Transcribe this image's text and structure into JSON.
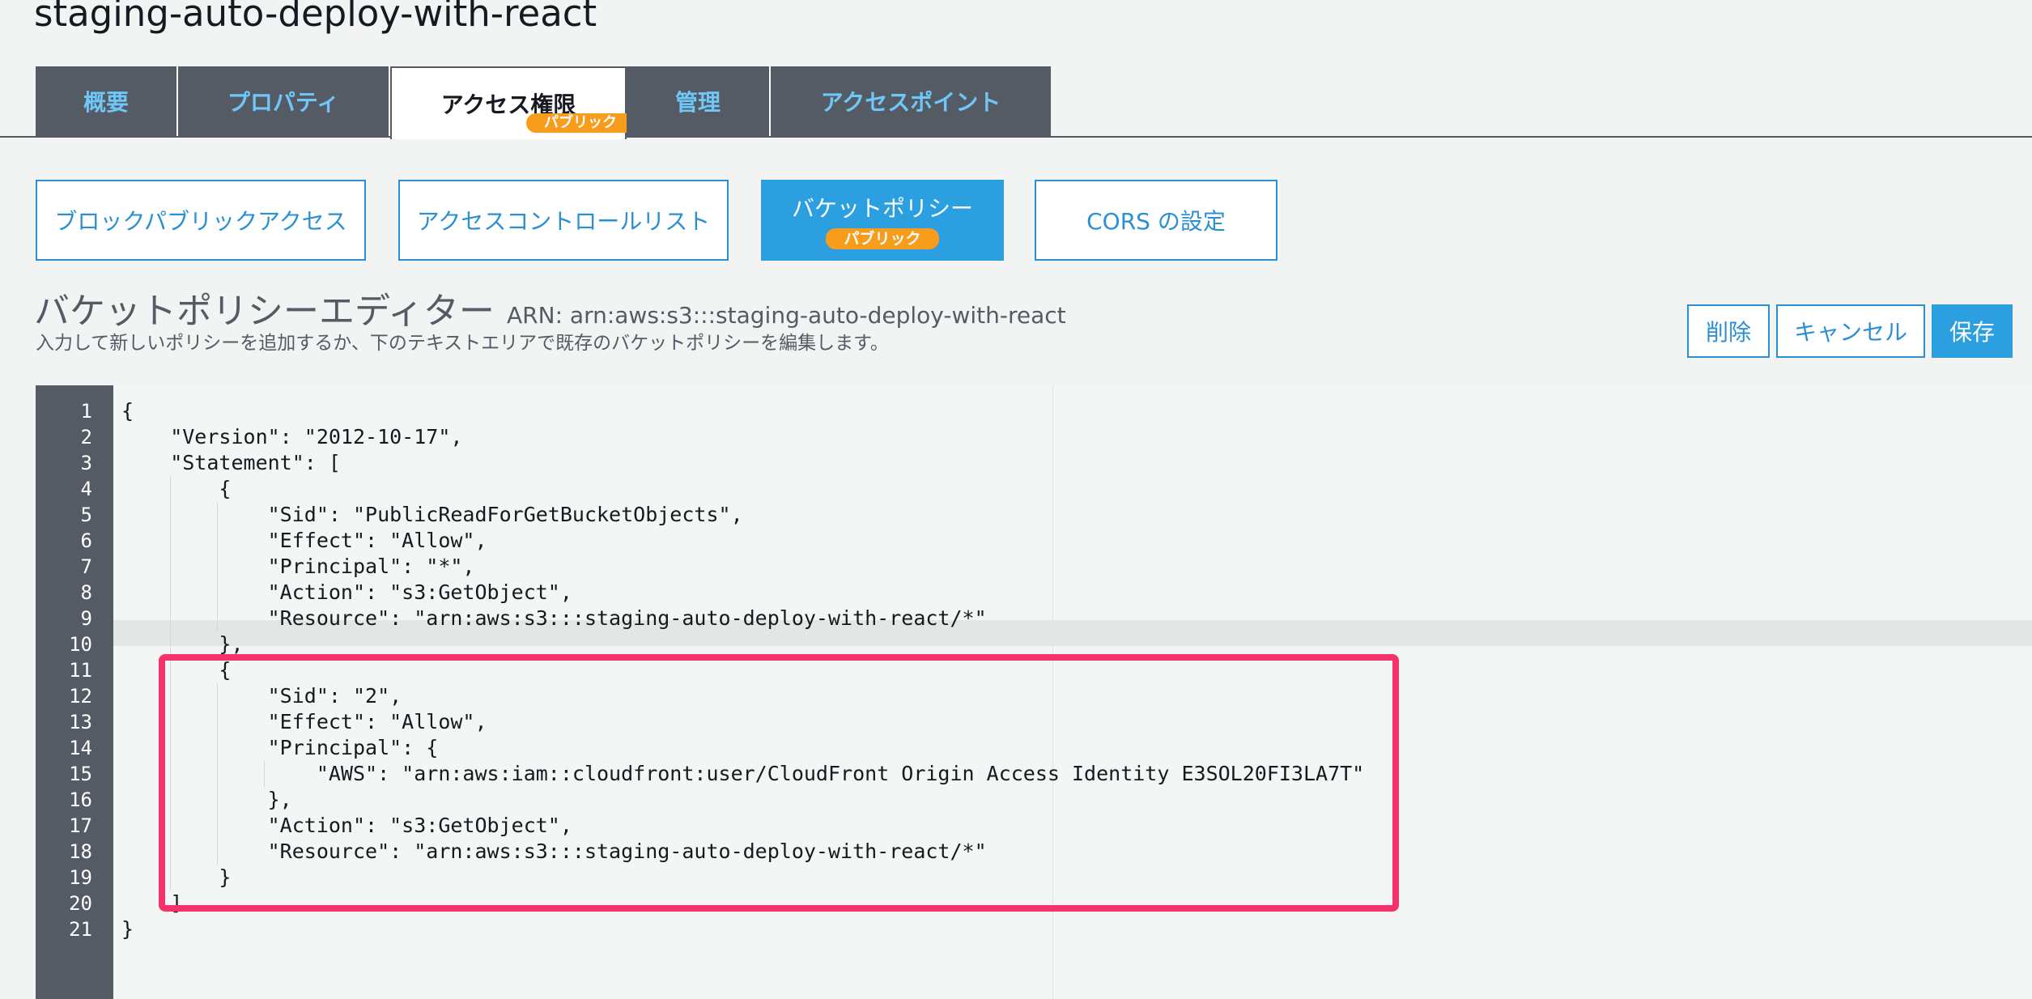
{
  "bucket": {
    "title": "staging-auto-deploy-with-react"
  },
  "tabs": [
    {
      "label": "概要"
    },
    {
      "label": "プロパティ"
    },
    {
      "label": "アクセス権限",
      "badge": "パブリック"
    },
    {
      "label": "管理"
    },
    {
      "label": "アクセスポイント"
    }
  ],
  "subnav": {
    "block_public_access": "ブロックパブリックアクセス",
    "acl": "アクセスコントロールリスト",
    "bucket_policy": "バケットポリシー",
    "bucket_policy_badge": "パブリック",
    "cors": "CORS の設定"
  },
  "editor": {
    "title": "バケットポリシーエディター",
    "arn": "ARN: arn:aws:s3:::staging-auto-deploy-with-react",
    "description": "入力して新しいポリシーを追加するか、下のテキストエリアで既存のバケットポリシーを編集します。",
    "actions": {
      "delete": "削除",
      "cancel": "キャンセル",
      "save": "保存"
    },
    "line_numbers": [
      "1",
      "2",
      "3",
      "4",
      "5",
      "6",
      "7",
      "8",
      "9",
      "10",
      "11",
      "12",
      "13",
      "14",
      "15",
      "16",
      "17",
      "18",
      "19",
      "20",
      "21"
    ],
    "lines": [
      "{",
      "    \"Version\": \"2012-10-17\",",
      "    \"Statement\": [",
      "        {",
      "            \"Sid\": \"PublicReadForGetBucketObjects\",",
      "            \"Effect\": \"Allow\",",
      "            \"Principal\": \"*\",",
      "            \"Action\": \"s3:GetObject\",",
      "            \"Resource\": \"arn:aws:s3:::staging-auto-deploy-with-react/*\"",
      "        },",
      "        {",
      "            \"Sid\": \"2\",",
      "            \"Effect\": \"Allow\",",
      "            \"Principal\": {",
      "                \"AWS\": \"arn:aws:iam::cloudfront:user/CloudFront Origin Access Identity E3SOL20FI3LA7T\"",
      "            },",
      "            \"Action\": \"s3:GetObject\",",
      "            \"Resource\": \"arn:aws:s3:::staging-auto-deploy-with-react/*\"",
      "        }",
      "    ]",
      "}"
    ]
  },
  "colors": {
    "accent": "#2b9fe0",
    "tab_bg": "#545b64",
    "tab_text": "#6ec7f7",
    "badge": "#f89c1c",
    "highlight": "#f5336a"
  }
}
